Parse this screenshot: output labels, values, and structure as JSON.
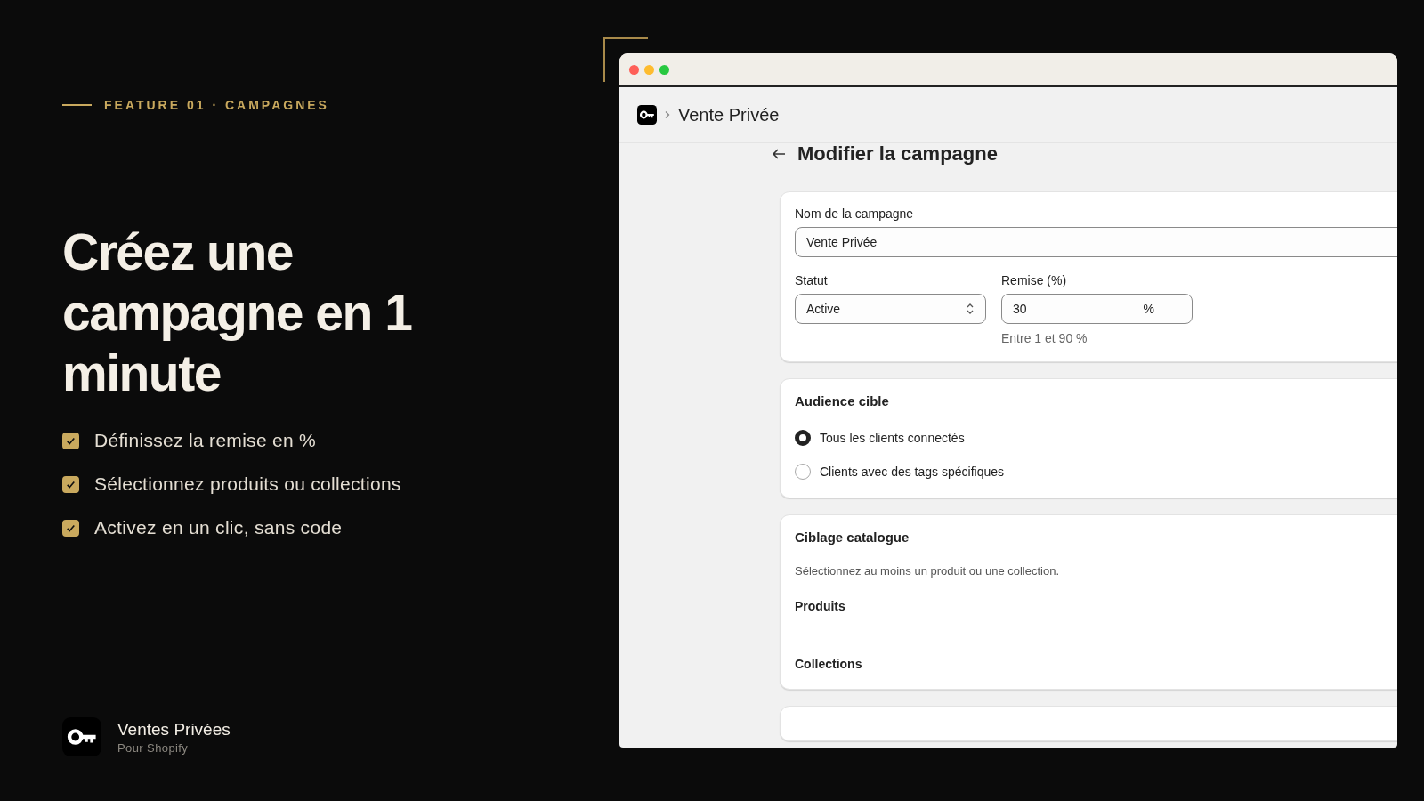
{
  "eyebrow": "FEATURE 01 · CAMPAGNES",
  "headline": "Créez une campagne en 1 minute",
  "features": [
    {
      "text": "Définissez la remise en %",
      "checked": true
    },
    {
      "text": "Sélectionnez produits ou collections",
      "checked": true
    },
    {
      "text": "Activez en un clic, sans code",
      "checked": true
    }
  ],
  "brand": {
    "name": "Ventes Privées",
    "tagline": "Pour Shopify"
  },
  "window": {
    "breadcrumb": "Vente Privée",
    "page_title": "Modifier la campagne",
    "general": {
      "name_label": "Nom de la campagne",
      "name_value": "Vente Privée",
      "status_label": "Statut",
      "status_value": "Active",
      "discount_label": "Remise (%)",
      "discount_value": "30",
      "discount_suffix": "%",
      "discount_help": "Entre 1 et 90 %"
    },
    "audience": {
      "title": "Audience cible",
      "options": [
        {
          "label": "Tous les clients connectés",
          "selected": true
        },
        {
          "label": "Clients avec des tags spécifiques",
          "selected": false
        }
      ]
    },
    "catalogue": {
      "title": "Ciblage catalogue",
      "description": "Sélectionnez au moins un produit ou une collection.",
      "sections": [
        "Produits",
        "Collections"
      ]
    }
  }
}
